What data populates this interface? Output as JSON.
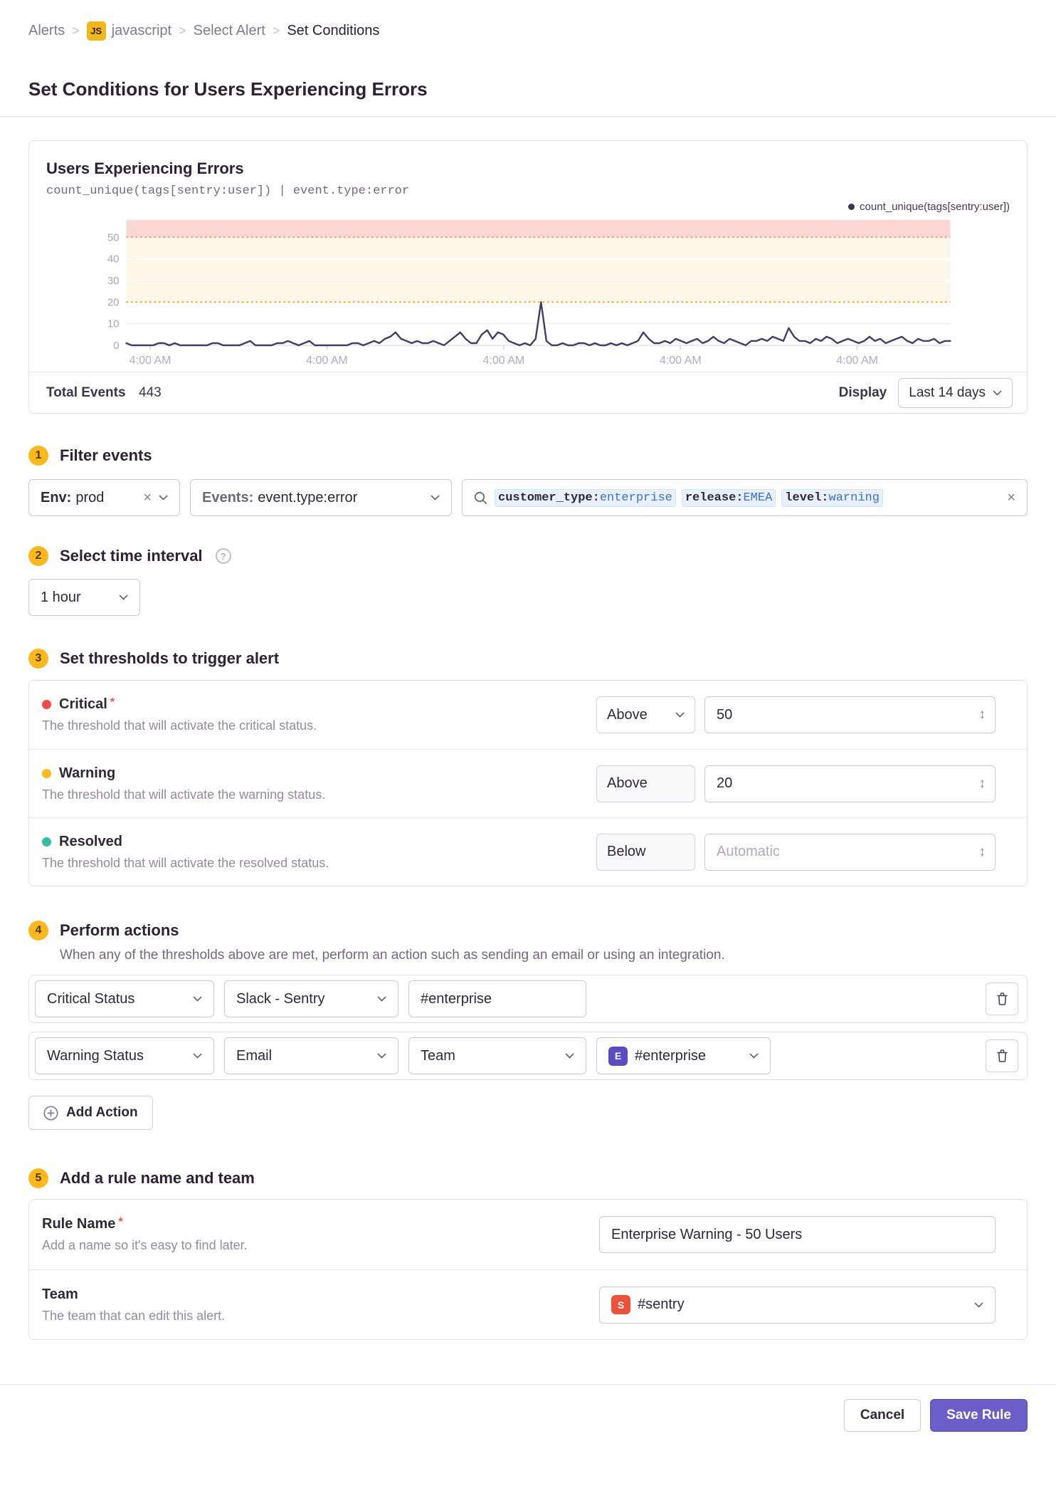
{
  "breadcrumb": {
    "items": [
      "Alerts",
      "javascript",
      "Select Alert",
      "Set Conditions"
    ],
    "project_badge": "JS",
    "separator": ">"
  },
  "page": {
    "title": "Set Conditions for Users Experiencing Errors"
  },
  "chart_card": {
    "title": "Users Experiencing Errors",
    "query": "count_unique(tags[sentry:user])  |  event.type:error",
    "legend": "count_unique(tags[sentry:user])",
    "total_events_label": "Total Events",
    "total_events_value": "443",
    "display_label": "Display",
    "display_value": "Last 14 days"
  },
  "chart_data": {
    "type": "line",
    "title": "Users Experiencing Errors",
    "ylabel": "",
    "xlabel": "",
    "ylim": [
      0,
      58
    ],
    "y_ticks": [
      0,
      10,
      20,
      30,
      40,
      50
    ],
    "x_tick_labels": [
      "4:00 AM",
      "4:00 AM",
      "4:00 AM",
      "4:00 AM",
      "4:00 AM"
    ],
    "legend_position": "top-right",
    "grid": true,
    "thresholds": {
      "critical": 50,
      "warning": 20
    },
    "bands": [
      {
        "from": 50,
        "to": 58,
        "color": "#fbd7d3"
      },
      {
        "from": 20,
        "to": 50,
        "color": "#fdf7e9"
      }
    ],
    "series": [
      {
        "name": "count_unique(tags[sentry:user])",
        "values": [
          1,
          0,
          0,
          0,
          0,
          0,
          1,
          1,
          0,
          1,
          0,
          0,
          0,
          0,
          0,
          0,
          1,
          1,
          0,
          0,
          0,
          0,
          1,
          2,
          0,
          0,
          0,
          0,
          1,
          1,
          2,
          1,
          0,
          1,
          2,
          0,
          0,
          0,
          0,
          0,
          0,
          0,
          1,
          1,
          0,
          1,
          2,
          1,
          3,
          4,
          6,
          3,
          2,
          1,
          2,
          1,
          1,
          2,
          1,
          0,
          2,
          4,
          6,
          3,
          1,
          1,
          5,
          7,
          3,
          6,
          5,
          2,
          1,
          0,
          1,
          0,
          3,
          20,
          2,
          0,
          0,
          1,
          0,
          0,
          1,
          1,
          0,
          1,
          0,
          0,
          1,
          0,
          1,
          0,
          1,
          2,
          6,
          3,
          1,
          1,
          2,
          1,
          3,
          2,
          1,
          2,
          3,
          1,
          2,
          4,
          2,
          1,
          3,
          2,
          1,
          0,
          2,
          2,
          3,
          2,
          4,
          3,
          2,
          8,
          4,
          2,
          2,
          1,
          3,
          2,
          4,
          3,
          1,
          2,
          3,
          2,
          1,
          2,
          4,
          2,
          3,
          1,
          2,
          3,
          4,
          2,
          1,
          3,
          2,
          2,
          3,
          1,
          2,
          2
        ]
      }
    ]
  },
  "sections": {
    "filter": {
      "number": "1",
      "title": "Filter events",
      "env_label": "Env:",
      "env_value": "prod",
      "events_label": "Events:",
      "events_value": "event.type:error",
      "tokens": [
        {
          "key": "customer_type:",
          "value": "enterprise"
        },
        {
          "key": "release:",
          "value": "EMEA"
        },
        {
          "key": "level:",
          "value": "warning"
        }
      ]
    },
    "interval": {
      "number": "2",
      "title": "Select time interval",
      "value": "1 hour",
      "help": "?"
    },
    "thresholds": {
      "number": "3",
      "title": "Set thresholds to trigger alert",
      "rows": [
        {
          "label": "Critical",
          "required": "*",
          "description": "The threshold that will activate the critical status.",
          "condition": "Above",
          "value": "50",
          "placeholder": ""
        },
        {
          "label": "Warning",
          "description": "The threshold that will activate the warning status.",
          "condition": "Above",
          "value": "20",
          "placeholder": ""
        },
        {
          "label": "Resolved",
          "description": "The threshold that will activate the resolved status.",
          "condition": "Below",
          "value": "",
          "placeholder": "Automatic"
        }
      ]
    },
    "actions": {
      "number": "4",
      "title": "Perform actions",
      "description": "When any of the thresholds above are met, perform an action such as sending an email or using an integration.",
      "row1": {
        "status": "Critical Status",
        "service": "Slack - Sentry",
        "target": "#enterprise"
      },
      "row2": {
        "status": "Warning Status",
        "service": "Email",
        "target_type": "Team",
        "team_badge": "E",
        "team_value": "#enterprise"
      },
      "add_button": "Add Action"
    },
    "rule": {
      "number": "5",
      "title": "Add a rule name and team",
      "name_label": "Rule Name",
      "name_required": "*",
      "name_description": "Add a name so it's easy to find later.",
      "name_value": "Enterprise Warning - 50 Users",
      "team_label": "Team",
      "team_description": "The team that can edit this alert.",
      "team_badge": "S",
      "team_value": "#sentry"
    }
  },
  "footer": {
    "cancel": "Cancel",
    "save": "Save Rule"
  },
  "icons": {
    "close": "×",
    "stepper": "↕",
    "help": "?"
  },
  "colors": {
    "accent_purple": "#6b5ec9",
    "number_circle": "#fdb81b",
    "project_badge_bg": "#f3b71a",
    "critical": "#fb4948",
    "warning": "#fdb81b",
    "resolved": "#31bf9c",
    "legend_dot": "#3b3350",
    "series_line": "#453c66",
    "critical_line": "#f2968f",
    "warning_line": "#f7a80c",
    "team_avatar_purple": "#5d4bc4",
    "team_avatar_orange": "#ee5039"
  }
}
